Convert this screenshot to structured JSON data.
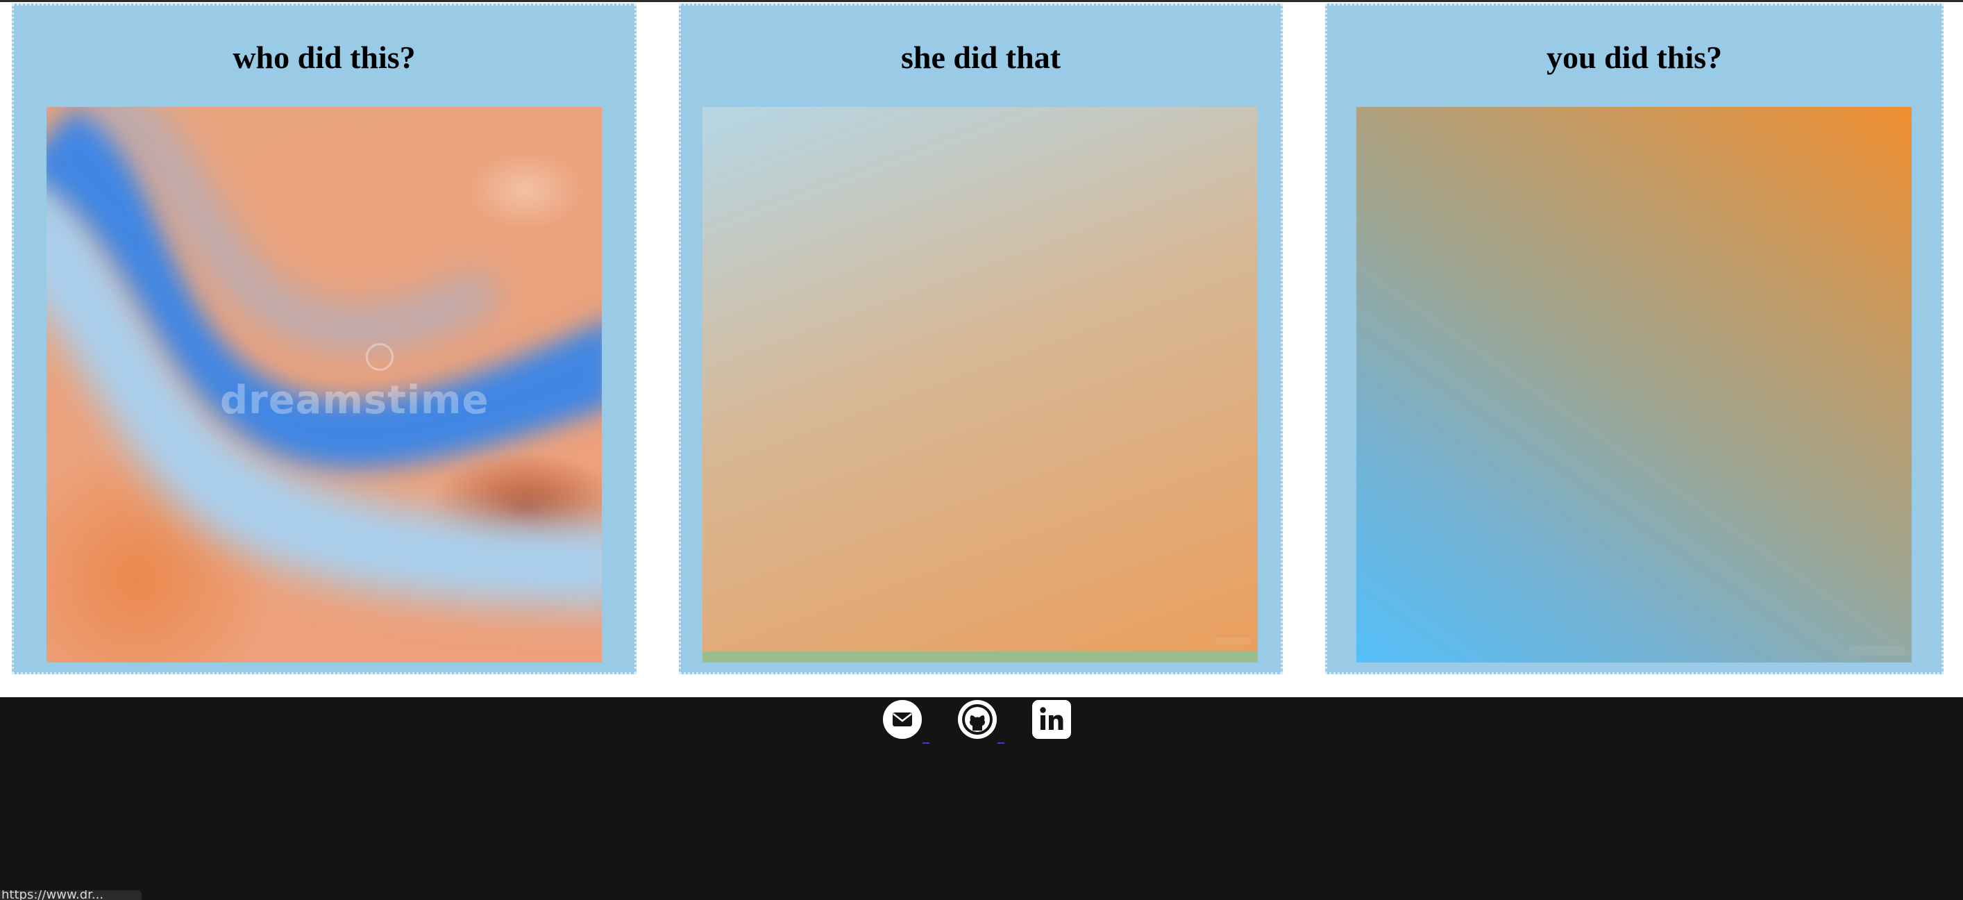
{
  "cards": [
    {
      "title": "who did this?",
      "watermark": "dreamstime"
    },
    {
      "title": "she did that"
    },
    {
      "title": "you did this?"
    }
  ],
  "footer": {
    "links": [
      {
        "icon": "email-icon"
      },
      {
        "icon": "github-icon"
      },
      {
        "icon": "linkedin-icon"
      }
    ]
  },
  "status_bar": {
    "url": "https://www.dr..."
  },
  "colors": {
    "card_background": "#99cbe7",
    "footer_background": "#141414"
  }
}
